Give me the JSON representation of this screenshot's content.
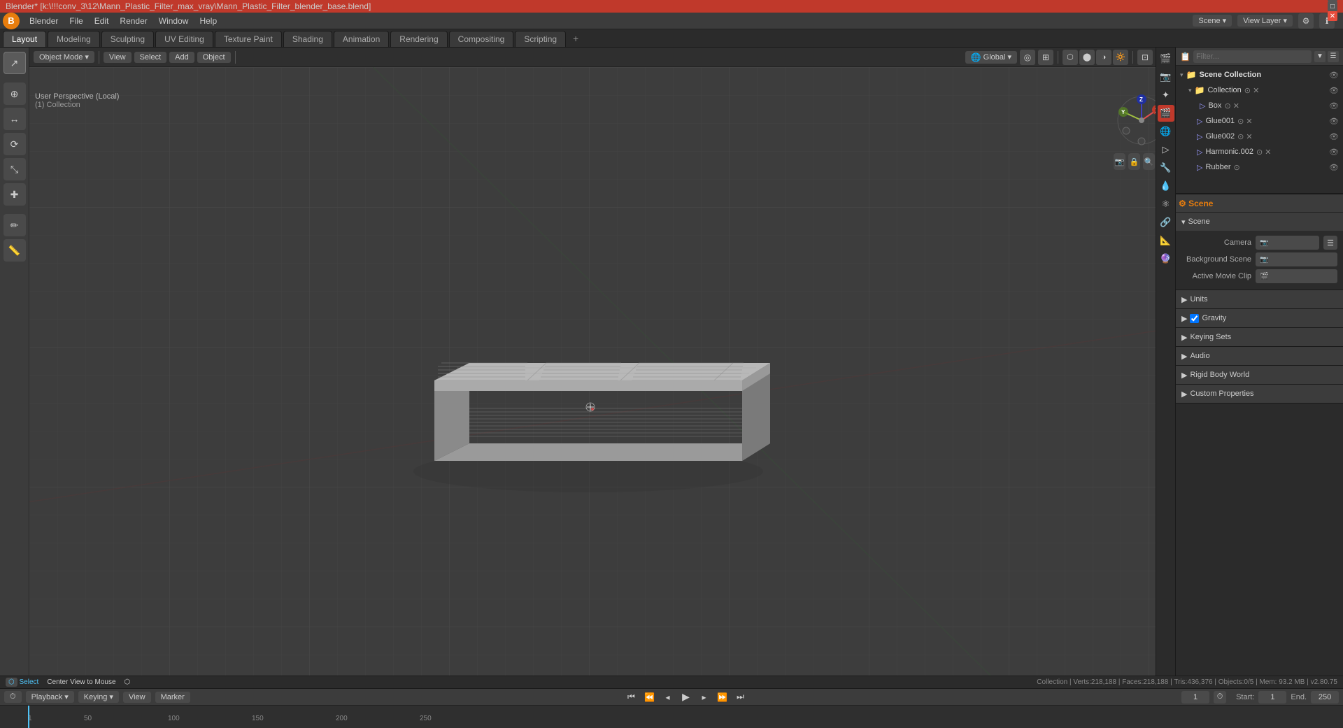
{
  "titlebar": {
    "title": "Blender* [k:\\!!!conv_3\\12\\Mann_Plastic_Filter_max_vray\\Mann_Plastic_Filter_blender_base.blend]",
    "minimize": "─",
    "maximize": "□",
    "close": "✕"
  },
  "menu": {
    "logo": "B",
    "items": [
      "Blender",
      "File",
      "Edit",
      "Render",
      "Window",
      "Help"
    ]
  },
  "workspace_tabs": {
    "tabs": [
      "Layout",
      "Modeling",
      "Sculpting",
      "UV Editing",
      "Texture Paint",
      "Shading",
      "Animation",
      "Rendering",
      "Compositing",
      "Scripting"
    ],
    "active": "Layout",
    "add_label": "+"
  },
  "top_right": {
    "scene_label": "Scene",
    "view_layer_label": "View Layer",
    "scene_value": "Scene",
    "view_layer_value": "View Layer"
  },
  "viewport": {
    "info_line1": "User Perspective (Local)",
    "info_line2": "(1) Collection",
    "mode_label": "Object Mode",
    "global_label": "Global",
    "header_buttons": [
      "Object Mode",
      "View",
      "Select",
      "Add",
      "Object"
    ]
  },
  "left_toolbar": {
    "tools": [
      "⟳",
      "↔",
      "↕",
      "⤡",
      "⊕",
      "✏",
      "⬡",
      "☐"
    ]
  },
  "outliner": {
    "title": "Scene Collection",
    "items": [
      {
        "name": "Scene Collection",
        "level": 0,
        "icon": "📁",
        "expanded": true
      },
      {
        "name": "Collection",
        "level": 1,
        "icon": "📁",
        "expanded": true
      },
      {
        "name": "Box",
        "level": 2,
        "icon": "▷",
        "has_eye": true
      },
      {
        "name": "Glue001",
        "level": 2,
        "icon": "▷",
        "has_eye": true
      },
      {
        "name": "Glue002",
        "level": 2,
        "icon": "▷",
        "has_eye": true
      },
      {
        "name": "Harmonic.002",
        "level": 2,
        "icon": "▷",
        "has_eye": true
      },
      {
        "name": "Rubber",
        "level": 2,
        "icon": "▷",
        "has_eye": true
      }
    ]
  },
  "properties_panel": {
    "tab_icons": [
      "🎬",
      "📷",
      "✦",
      "⚙",
      "🔲",
      "🔆",
      "📐",
      "💧",
      "🔶",
      "🔑"
    ],
    "active_tab": "scene",
    "scene_section": {
      "header": "Scene",
      "camera_label": "Camera",
      "camera_value": "",
      "background_scene_label": "Background Scene",
      "background_scene_value": "",
      "active_movie_clip_label": "Active Movie Clip",
      "active_movie_clip_value": ""
    },
    "units_section": {
      "header": "Units"
    },
    "gravity_section": {
      "header": "Gravity",
      "checkbox": true
    },
    "keying_sets_section": {
      "header": "Keying Sets"
    },
    "audio_section": {
      "header": "Audio"
    },
    "rigid_body_world_section": {
      "header": "Rigid Body World"
    },
    "custom_properties_section": {
      "header": "Custom Properties"
    }
  },
  "timeline": {
    "playback_label": "Playback",
    "keying_label": "Keying",
    "view_label": "View",
    "marker_label": "Marker",
    "start_label": "Start:",
    "start_value": "1",
    "end_label": "End.",
    "end_value": "250",
    "current_frame": "1",
    "ruler_marks": [
      "1",
      "50",
      "100",
      "150",
      "200",
      "250"
    ]
  },
  "statusbar": {
    "select_label": "Select",
    "center_view_label": "Center View to Mouse",
    "stats": "Collection | Verts:218,188 | Faces:218,188 | Tris:436,376 | Objects:0/5 | Mem: 93.2 MB | v2.80.75"
  }
}
